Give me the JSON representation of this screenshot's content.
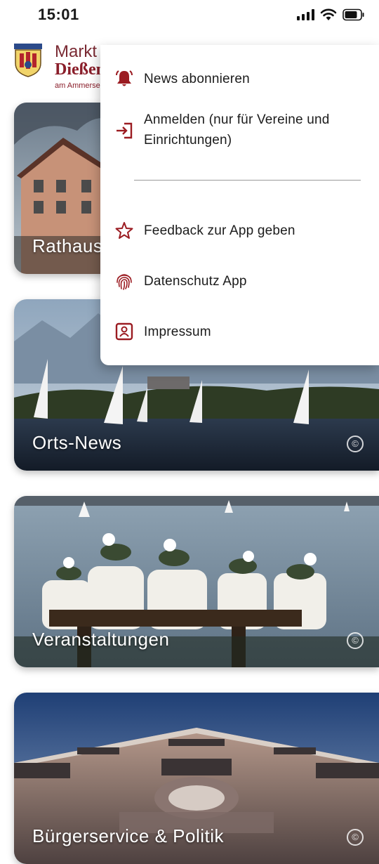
{
  "status_bar": {
    "time": "15:01"
  },
  "header": {
    "brand_line1": "Markt",
    "brand_line2": "Dießen",
    "brand_line3": "am Ammersee"
  },
  "tiles": [
    {
      "label": "Rathaus"
    },
    {
      "label": "Orts-News",
      "copyright": "©"
    },
    {
      "label": "Veranstaltungen",
      "copyright": "©"
    },
    {
      "label": "Bürgerservice & Politik",
      "copyright": "©"
    }
  ],
  "menu": {
    "items": [
      {
        "label": "News abonnieren",
        "icon": "bell-icon"
      },
      {
        "label": "Anmelden (nur für Vereine und Einrichtungen)",
        "icon": "login-icon"
      },
      {
        "label": "Feedback zur App geben",
        "icon": "star-icon"
      },
      {
        "label": "Datenschutz App",
        "icon": "fingerprint-icon"
      },
      {
        "label": "Impressum",
        "icon": "contact-card-icon"
      }
    ]
  },
  "colors": {
    "brand": "#8a1e2a",
    "menu_icon": "#9b1c22"
  }
}
